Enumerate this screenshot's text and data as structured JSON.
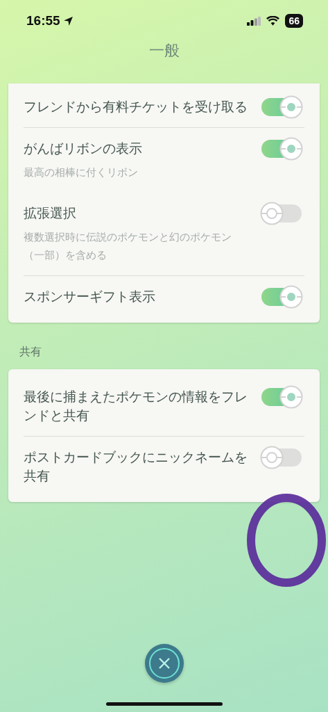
{
  "status_bar": {
    "time": "16:55",
    "battery": "66"
  },
  "title": "一般",
  "sections": [
    {
      "rows": [
        {
          "label": "フレンドから有料チケットを受け取る",
          "on": true
        },
        {
          "label": "がんばリボンの表示",
          "description": "最高の相棒に付くリボン",
          "on": true
        },
        {
          "label": "拡張選択",
          "description": "複数選択時に伝説のポケモンと幻のポケモン（一部）を含める",
          "on": false
        },
        {
          "label": "スポンサーギフト表示",
          "on": true
        }
      ]
    },
    {
      "header": "共有",
      "rows": [
        {
          "label": "最後に捕まえたポケモンの情報をフレンドと共有",
          "on": true
        },
        {
          "label": "ポストカードブックにニックネームを共有",
          "on": false
        }
      ]
    }
  ]
}
